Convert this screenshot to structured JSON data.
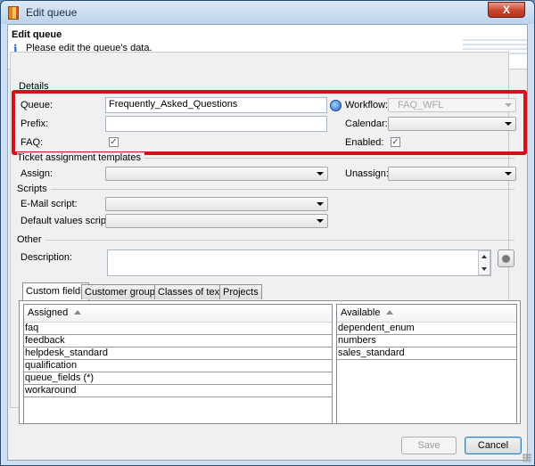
{
  "window": {
    "title": "Edit queue",
    "close_label": "X"
  },
  "header": {
    "title": "Edit queue",
    "subtitle": "Please edit the queue's data."
  },
  "details": {
    "section_label": "Details",
    "queue_label": "Queue:",
    "queue_value": "Frequently_Asked_Questions",
    "prefix_label": "Prefix:",
    "prefix_value": "",
    "faq_label": "FAQ:",
    "faq_checked": true,
    "workflow_label": "Workflow:",
    "workflow_value": "FAQ_WFL",
    "calendar_label": "Calendar:",
    "calendar_value": "",
    "enabled_label": "Enabled:",
    "enabled_checked": true,
    "highlight_color": "#d0121a"
  },
  "ticket_assignment": {
    "section_label": "Ticket assignment templates",
    "assign_label": "Assign:",
    "assign_value": "",
    "unassign_label": "Unassign:",
    "unassign_value": ""
  },
  "scripts": {
    "section_label": "Scripts",
    "email_script_label": "E-Mail script:",
    "email_script_value": "",
    "default_values_label": "Default values script:",
    "default_values_value": ""
  },
  "other": {
    "section_label": "Other",
    "description_label": "Description:",
    "description_value": ""
  },
  "tabs": [
    {
      "label": "Custom fields",
      "active": true
    },
    {
      "label": "Customer groups",
      "active": false
    },
    {
      "label": "Classes of text",
      "active": false
    },
    {
      "label": "Projects",
      "active": false
    }
  ],
  "assigned": {
    "header": "Assigned",
    "items": [
      "faq",
      "feedback",
      "helpdesk_standard",
      "qualification",
      "queue_fields (*)",
      "workaround"
    ]
  },
  "available": {
    "header": "Available",
    "items": [
      "dependent_enum",
      "numbers",
      "sales_standard"
    ]
  },
  "footer": {
    "save_label": "Save",
    "cancel_label": "Cancel"
  },
  "icons": {
    "info": "info-icon",
    "globe": "globe-icon",
    "sort": "sort-ascending-icon"
  }
}
